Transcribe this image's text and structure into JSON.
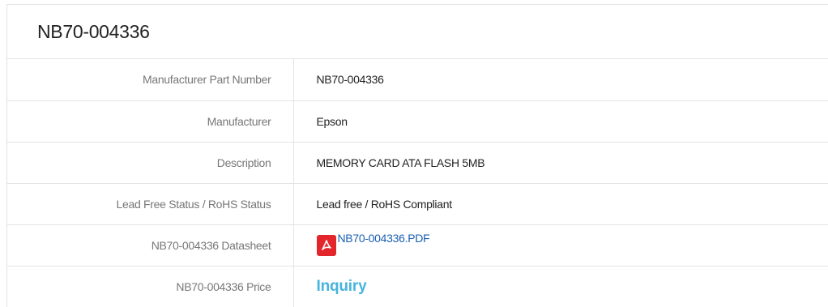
{
  "header": {
    "title": "NB70-004336"
  },
  "specs": [
    {
      "label": "Manufacturer Part Number",
      "value": "NB70-004336"
    },
    {
      "label": "Manufacturer",
      "value": "Epson"
    },
    {
      "label": "Description",
      "value": "MEMORY CARD ATA FLASH 5MB"
    },
    {
      "label": "Lead Free Status / RoHS Status",
      "value": "Lead free / RoHS Compliant"
    }
  ],
  "datasheet": {
    "label": "NB70-004336 Datasheet",
    "file_name": "NB70-004336.PDF",
    "icon": "pdf-icon"
  },
  "price": {
    "label": "NB70-004336 Price",
    "action_label": "Inquiry"
  },
  "colors": {
    "link": "#1a5fb4",
    "inquiry": "#46b4dd",
    "pdf_icon": "#e3262c",
    "border": "#e3e3e3"
  }
}
